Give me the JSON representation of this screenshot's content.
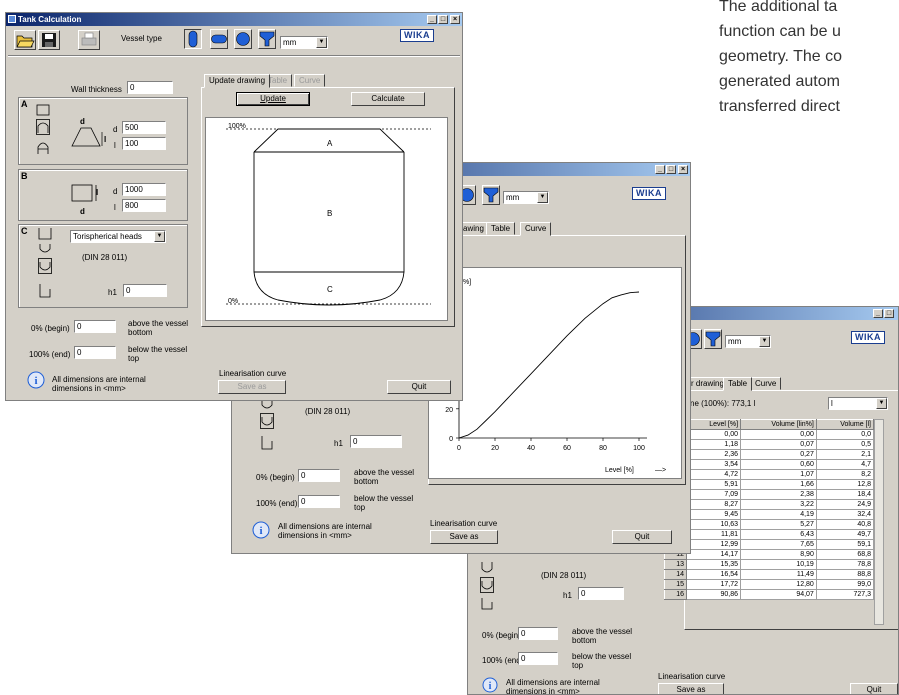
{
  "description_lines": [
    "The additional ta",
    "function can be u",
    "geometry. The co",
    "generated autom",
    "transferred direct"
  ],
  "window_title": "Tank Calculation",
  "caption_buttons": [
    "_",
    "□",
    "×"
  ],
  "toolbar": {
    "vessel_type_label": "Vessel type",
    "unit_value": "mm",
    "brand": "WIKA"
  },
  "main": {
    "wall_thickness_label": "Wall thickness",
    "wall_thickness_value": "0",
    "section_a": {
      "letter": "A",
      "d_label": "d",
      "d_value": "500",
      "l_label": "l",
      "l_value": "100",
      "dim_d": "d",
      "dim_l": "l"
    },
    "section_b": {
      "letter": "B",
      "d_label": "d",
      "d_value": "1000",
      "l_label": "l",
      "l_value": "800",
      "dim_d": "d",
      "dim_l": "l"
    },
    "section_c": {
      "letter": "C",
      "head_type": "Torispherical heads",
      "standard": "(DIN 28 011)",
      "h1_label": "h1",
      "h1_value": "0"
    },
    "begin_label": "0% (begin)",
    "begin_value": "0",
    "begin_desc": [
      "above the vessel",
      "bottom"
    ],
    "end_label": "100% (end)",
    "end_value": "0",
    "end_desc": [
      "below the vessel",
      "top"
    ],
    "info_text": [
      "All dimensions are internal",
      "dimensions in <mm>"
    ],
    "tabs": [
      "Update drawing",
      "Table",
      "Curve"
    ],
    "update_button": "Update",
    "calculate_button": "Calculate",
    "drawing": {
      "label_100": "100%",
      "label_0": "0%",
      "label_a": "A",
      "label_b": "B",
      "label_c": "C"
    },
    "linearisation_label": "Linearisation curve",
    "save_as_button": "Save as",
    "quit_button": "Quit"
  },
  "curve_window": {
    "tabs": [
      "r drawing",
      "Table",
      "Curve"
    ],
    "y_axis_label": "olume [lin%]",
    "x_axis_label": "Level [%]",
    "arrow": "—>",
    "x_ticks": [
      "0",
      "20",
      "40",
      "60",
      "80",
      "100"
    ],
    "y_ticks": [
      "20",
      "0"
    ],
    "standard": "(DIN 28 011)",
    "h1_label": "h1",
    "h1_value": "0",
    "begin_label": "0% (begin)",
    "begin_value": "0",
    "begin_desc": [
      "above the vessel",
      "bottom"
    ],
    "end_label": "100% (end)",
    "end_value": "0",
    "end_desc": [
      "below the vessel",
      "top"
    ],
    "info_text": [
      "All dimensions are internal",
      "dimensions in <mm>"
    ],
    "linearisation_label": "Linearisation curve",
    "save_as_button": "Save as",
    "quit_button": "Quit"
  },
  "chart_data": {
    "type": "line",
    "x": [
      0,
      5,
      10,
      15,
      20,
      30,
      40,
      50,
      60,
      70,
      80,
      85,
      90,
      95,
      100
    ],
    "y": [
      0,
      2,
      6,
      12,
      18,
      31,
      44,
      57,
      70,
      82,
      92,
      96,
      98,
      99.5,
      100
    ],
    "xlabel": "Level [%]",
    "ylabel": "olume [lin%]",
    "xlim": [
      0,
      100
    ],
    "ylim": [
      0,
      100
    ],
    "grid": false
  },
  "table_window": {
    "tabs": [
      "r drawing",
      "Table",
      "Curve"
    ],
    "summary": "ne (100%): 773,1 l",
    "unit_value": "l",
    "columns": [
      "Level [%]",
      "Volume [lin%]",
      "Volume [l]"
    ],
    "rows": [
      {
        "idx": "",
        "level": "0,00",
        "lin": "0,00",
        "vol": "0,0"
      },
      {
        "idx": "",
        "level": "1,18",
        "lin": "0,07",
        "vol": "0,5"
      },
      {
        "idx": "",
        "level": "2,36",
        "lin": "0,27",
        "vol": "2,1"
      },
      {
        "idx": "",
        "level": "3,54",
        "lin": "0,60",
        "vol": "4,7"
      },
      {
        "idx": "",
        "level": "4,72",
        "lin": "1,07",
        "vol": "8,2"
      },
      {
        "idx": "",
        "level": "5,91",
        "lin": "1,66",
        "vol": "12,8"
      },
      {
        "idx": "",
        "level": "7,09",
        "lin": "2,38",
        "vol": "18,4"
      },
      {
        "idx": "",
        "level": "8,27",
        "lin": "3,22",
        "vol": "24,9"
      },
      {
        "idx": "",
        "level": "9,45",
        "lin": "4,19",
        "vol": "32,4"
      },
      {
        "idx": "",
        "level": "10,63",
        "lin": "5,27",
        "vol": "40,8"
      },
      {
        "idx": "",
        "level": "11,81",
        "lin": "6,43",
        "vol": "49,7"
      },
      {
        "idx": "11",
        "level": "12,99",
        "lin": "7,65",
        "vol": "59,1"
      },
      {
        "idx": "12",
        "level": "14,17",
        "lin": "8,90",
        "vol": "68,8"
      },
      {
        "idx": "13",
        "level": "15,35",
        "lin": "10,19",
        "vol": "78,8"
      },
      {
        "idx": "14",
        "level": "16,54",
        "lin": "11,49",
        "vol": "88,8"
      },
      {
        "idx": "15",
        "level": "17,72",
        "lin": "12,80",
        "vol": "99,0"
      },
      {
        "idx": "16",
        "level": "90,86",
        "lin": "94,07",
        "vol": "727,3"
      }
    ],
    "standard": "(DIN 28 011)",
    "h1_label": "h1",
    "h1_value": "0",
    "begin_label": "0% (begin)",
    "begin_value": "0",
    "begin_desc": [
      "above the vessel",
      "bottom"
    ],
    "end_label": "100% (end)",
    "end_value": "0",
    "end_desc": [
      "below the vessel",
      "top"
    ],
    "info_text": [
      "All dimensions are internal",
      "dimensions in <mm>"
    ],
    "linearisation_label": "Linearisation curve",
    "save_as_button": "Save as",
    "quit_button": "Quit"
  },
  "colors": {
    "title_bar": "#0a246a",
    "face": "#d4d0c8",
    "brand": "#1a3d8f",
    "icon_blue": "#1f5fd6"
  }
}
